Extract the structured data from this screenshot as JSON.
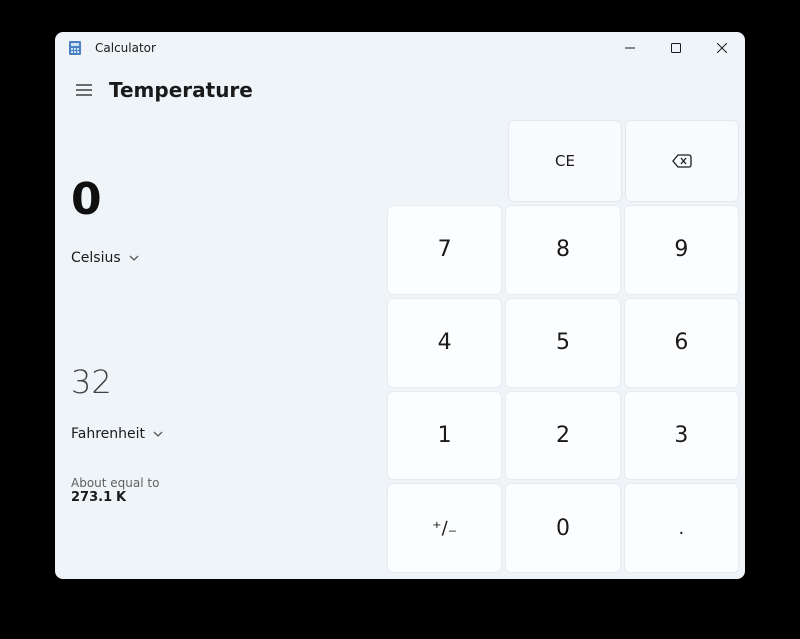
{
  "app": {
    "title": "Calculator",
    "mode": "Temperature"
  },
  "conversion": {
    "input_value": "0",
    "input_unit": "Celsius",
    "output_value": "32",
    "output_unit": "Fahrenheit",
    "about_label": "About equal to",
    "about_value": "273.1",
    "about_unit": "K"
  },
  "keys": {
    "ce": "CE",
    "n7": "7",
    "n8": "8",
    "n9": "9",
    "n4": "4",
    "n5": "5",
    "n6": "6",
    "n1": "1",
    "n2": "2",
    "n3": "3",
    "sign": "⁺∕₋",
    "n0": "0",
    "dot": "."
  }
}
